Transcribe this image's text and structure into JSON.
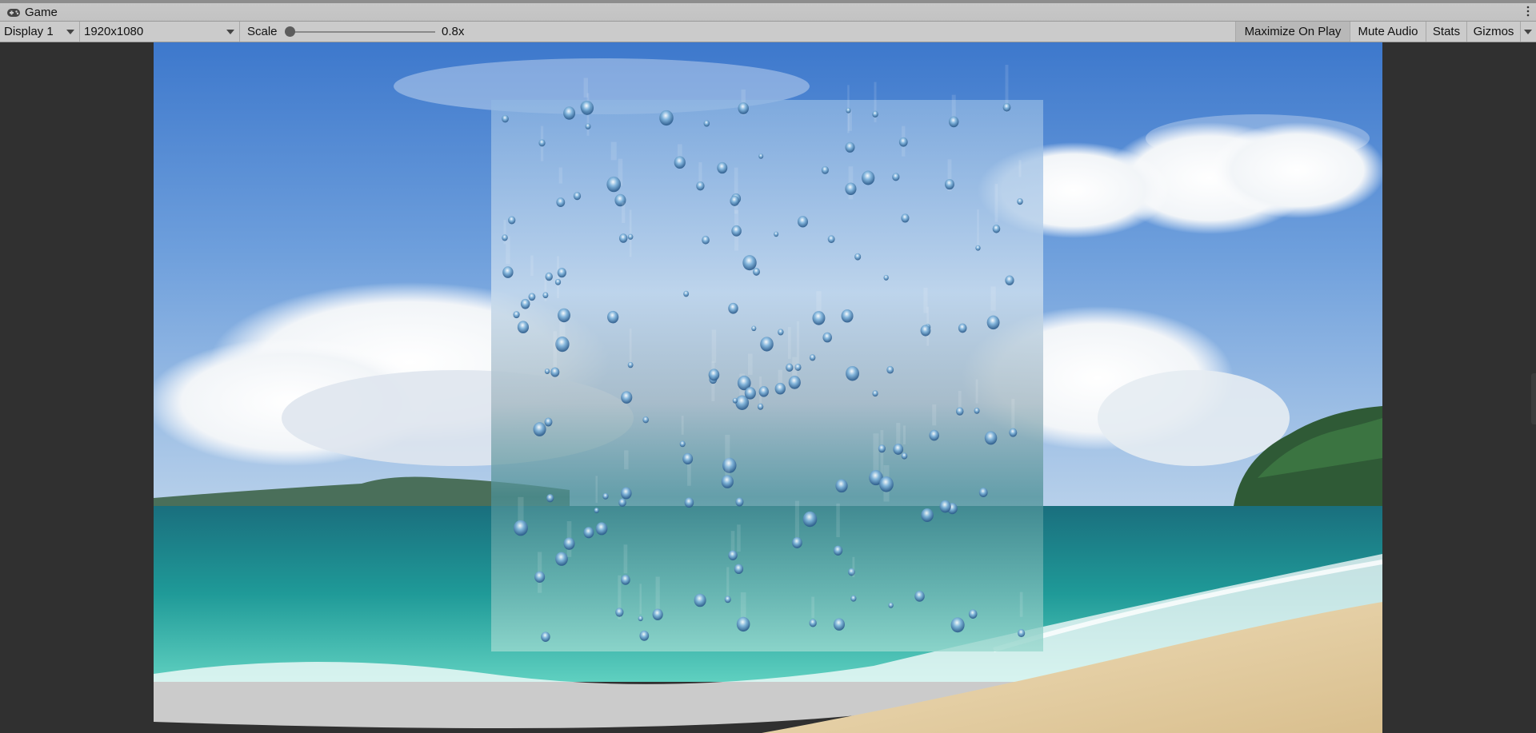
{
  "tab": {
    "title": "Game",
    "icon": "gamepad-icon"
  },
  "toolbar": {
    "display_label": "Display 1",
    "resolution_label": "1920x1080",
    "scale_label": "Scale",
    "scale_value": "0.8x",
    "scale_slider_level": 0.0,
    "buttons": {
      "maximize": "Maximize On Play",
      "mute": "Mute Audio",
      "stats": "Stats",
      "gizmos": "Gizmos"
    },
    "maximize_active": true
  },
  "colors": {
    "sky_top": "#3f7fd0",
    "sky_bottom": "#a9c9ea",
    "sea": "#1e8c8f",
    "sand": "#e6d2a8",
    "editor_bg": "#303030"
  }
}
